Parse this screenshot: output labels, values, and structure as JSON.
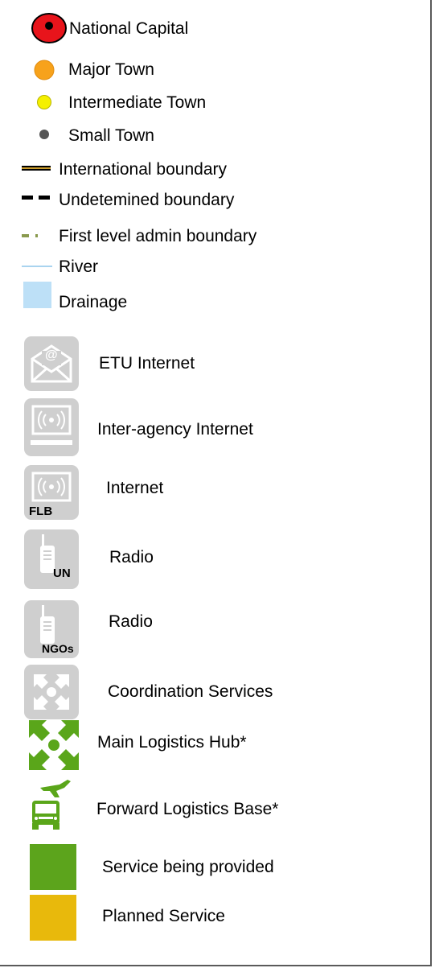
{
  "legend": {
    "items": {
      "national_capital": "National Capital",
      "major_town": "Major Town",
      "intermediate_town": "Intermediate Town",
      "small_town": "Small Town",
      "international_boundary": "International boundary",
      "undetermined_boundary": "Undetemined boundary",
      "first_level_admin_boundary": "First level admin boundary",
      "river": "River",
      "drainage": "Drainage",
      "etu_internet": "ETU Internet",
      "inter_agency_internet": "Inter-agency Internet",
      "internet": "Internet",
      "radio_un": "Radio",
      "radio_ngos": "Radio",
      "coordination_services": "Coordination Services",
      "main_logistics_hub": "Main Logistics Hub*",
      "forward_logistics_base": "Forward Logistics Base*",
      "service_provided": "Service being provided",
      "planned_service": "Planned Service"
    },
    "tags": {
      "flb": "FLB",
      "un": "UN",
      "ngos": "NGOs",
      "at": "@"
    },
    "colors": {
      "capital_fill": "#e8141b",
      "major_town": "#f7a21b",
      "intermediate_town": "#f5f000",
      "small_town": "#555555",
      "boundary_line": "#000000",
      "boundary_accent": "#c89a2a",
      "admin_boundary": "#8a9a4e",
      "river": "#a9d4ef",
      "drainage": "#bde0f7",
      "icon_grey": "#cfcfcf",
      "logistics_green": "#5aa61a",
      "service_green": "#5ca41c",
      "planned_yellow": "#e8b90c"
    }
  }
}
